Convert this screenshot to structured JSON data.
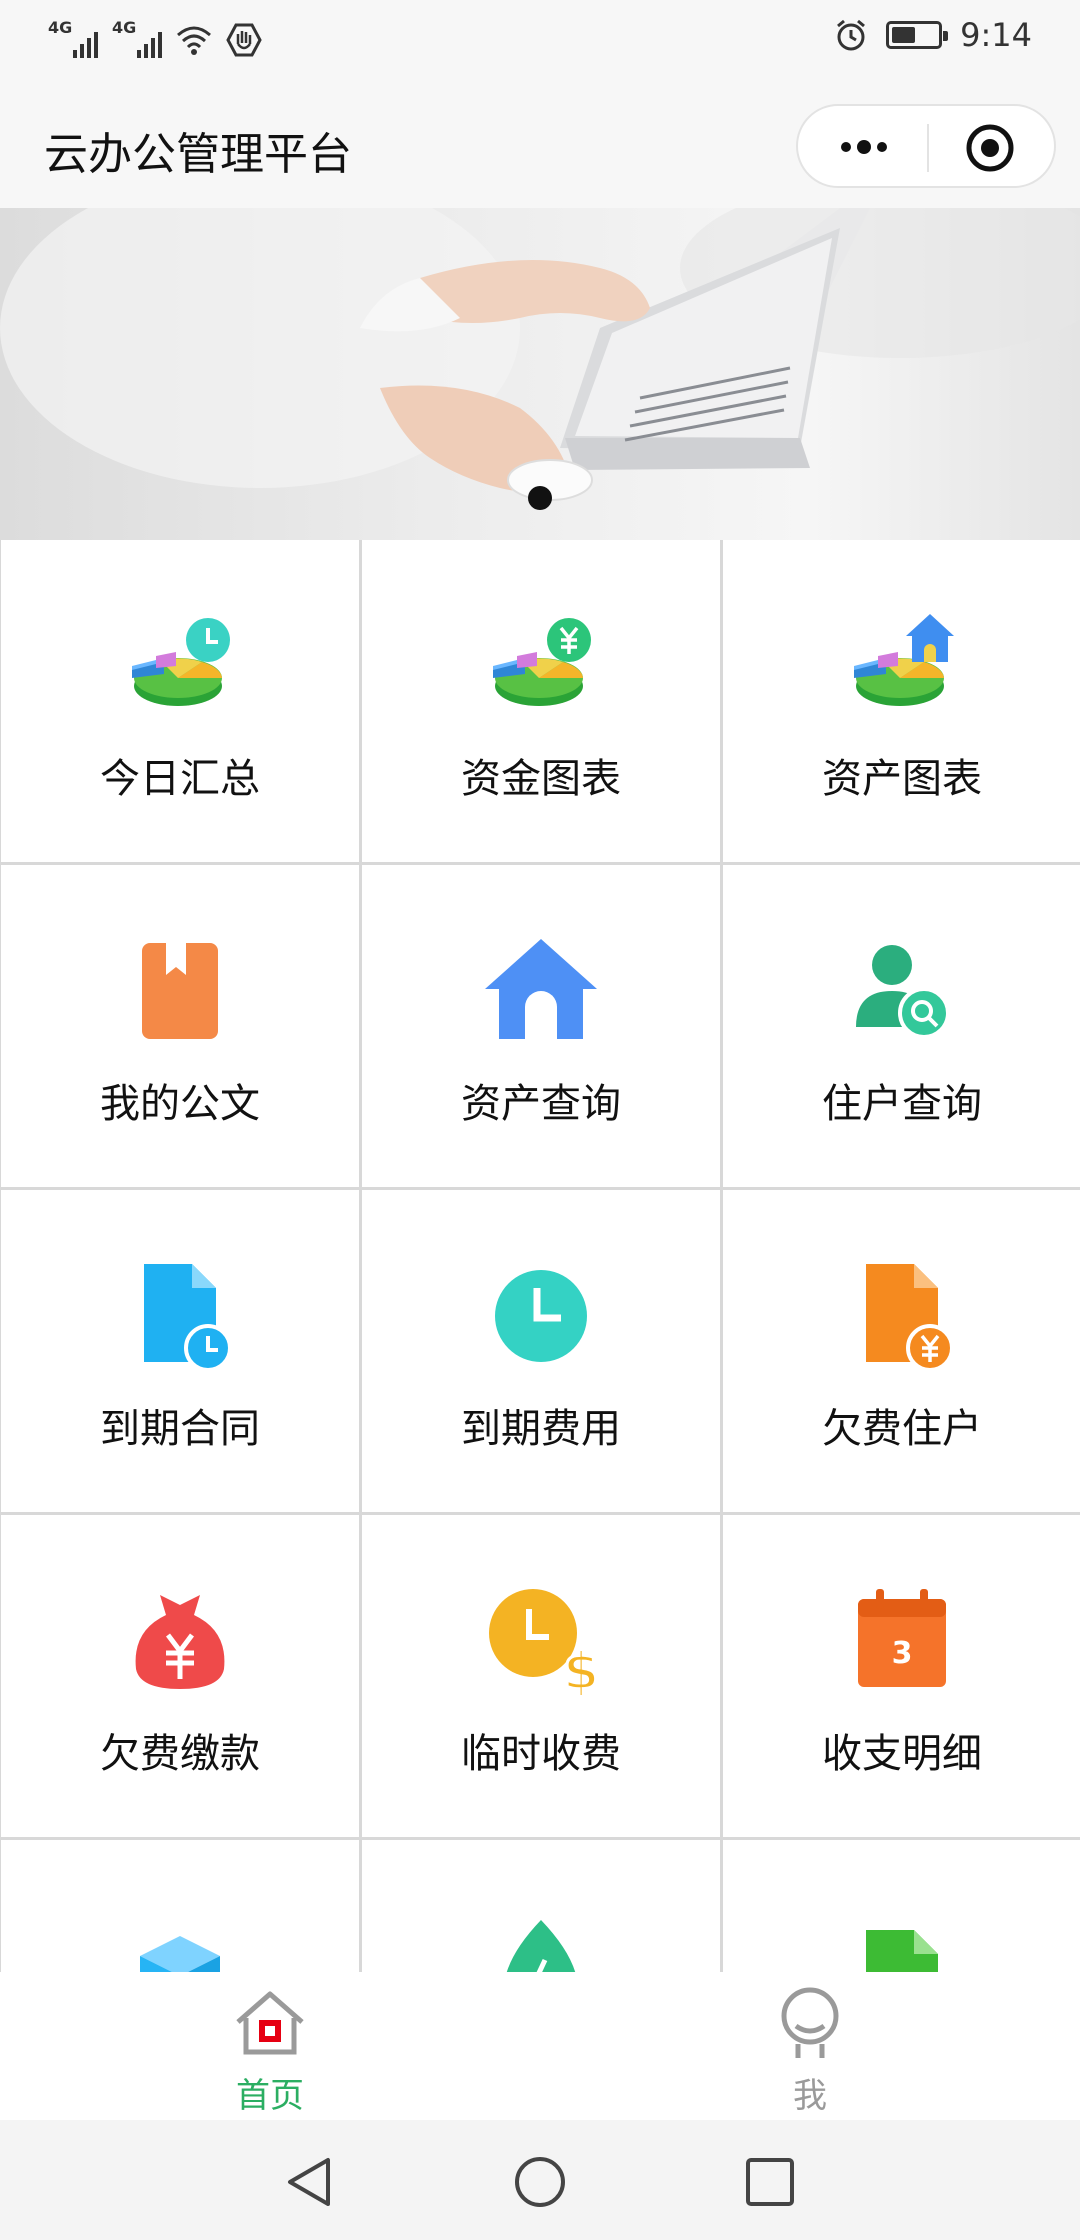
{
  "status_bar": {
    "time": "9:14",
    "network_labels": [
      "4G",
      "4G"
    ]
  },
  "header": {
    "title": "云办公管理平台",
    "more_icon": "more-dots-icon",
    "close_icon": "target-icon"
  },
  "banner": {
    "active_index": 0,
    "total": 1
  },
  "grid": {
    "items": [
      {
        "label": "今日汇总",
        "icon": "pie-chart-clock-icon"
      },
      {
        "label": "资金图表",
        "icon": "pie-chart-yen-icon"
      },
      {
        "label": "资产图表",
        "icon": "pie-chart-house-icon"
      },
      {
        "label": "我的公文",
        "icon": "document-icon"
      },
      {
        "label": "资产查询",
        "icon": "house-icon"
      },
      {
        "label": "住户查询",
        "icon": "user-search-icon"
      },
      {
        "label": "到期合同",
        "icon": "file-clock-icon"
      },
      {
        "label": "到期费用",
        "icon": "clock-icon"
      },
      {
        "label": "欠费住户",
        "icon": "file-yen-icon"
      },
      {
        "label": "欠费缴款",
        "icon": "money-bag-icon"
      },
      {
        "label": "临时收费",
        "icon": "clock-dollar-icon"
      },
      {
        "label": "收支明细",
        "icon": "calendar-icon"
      }
    ],
    "calendar_day": "3"
  },
  "tab_bar": {
    "home_label": "首页",
    "me_label": "我"
  },
  "colors": {
    "accent": "#2bae62",
    "inactive": "#9a9a9a"
  }
}
